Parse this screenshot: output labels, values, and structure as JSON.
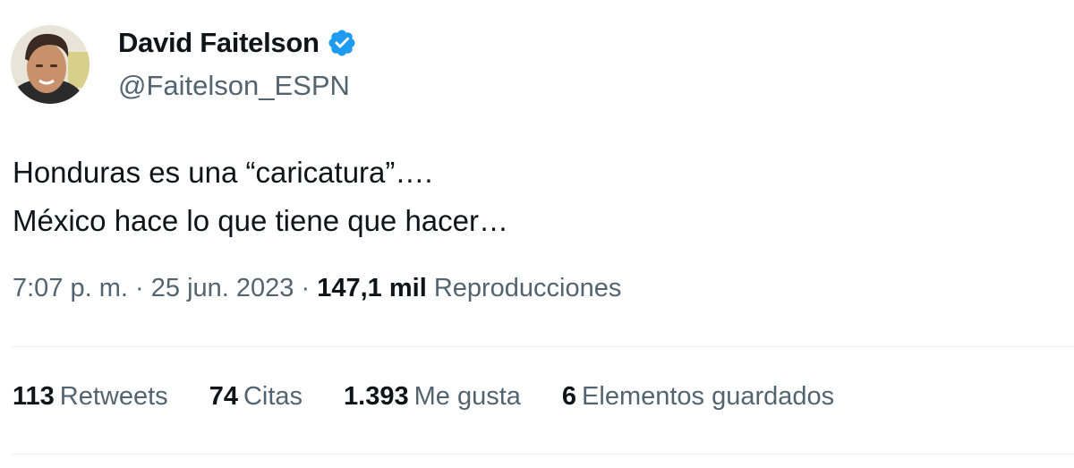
{
  "author": {
    "display_name": "David Faitelson",
    "handle": "@Faitelson_ESPN",
    "verified_icon": "verified-badge-icon",
    "verified_color": "#1d9bf0"
  },
  "tweet": {
    "lines": [
      "Honduras es una “caricatura”….",
      "México hace lo que tiene que hacer…"
    ]
  },
  "meta": {
    "time": "7:07 p. m.",
    "separator": "·",
    "date": "25 jun. 2023",
    "views_count": "147,1 mil",
    "views_label": "Reproducciones"
  },
  "stats": [
    {
      "count": "113",
      "label": "Retweets"
    },
    {
      "count": "74",
      "label": "Citas"
    },
    {
      "count": "1.393",
      "label": "Me gusta"
    },
    {
      "count": "6",
      "label": "Elementos guardados"
    }
  ],
  "colors": {
    "text": "#0f1419",
    "secondary": "#536471",
    "divider": "#eff3f4"
  }
}
